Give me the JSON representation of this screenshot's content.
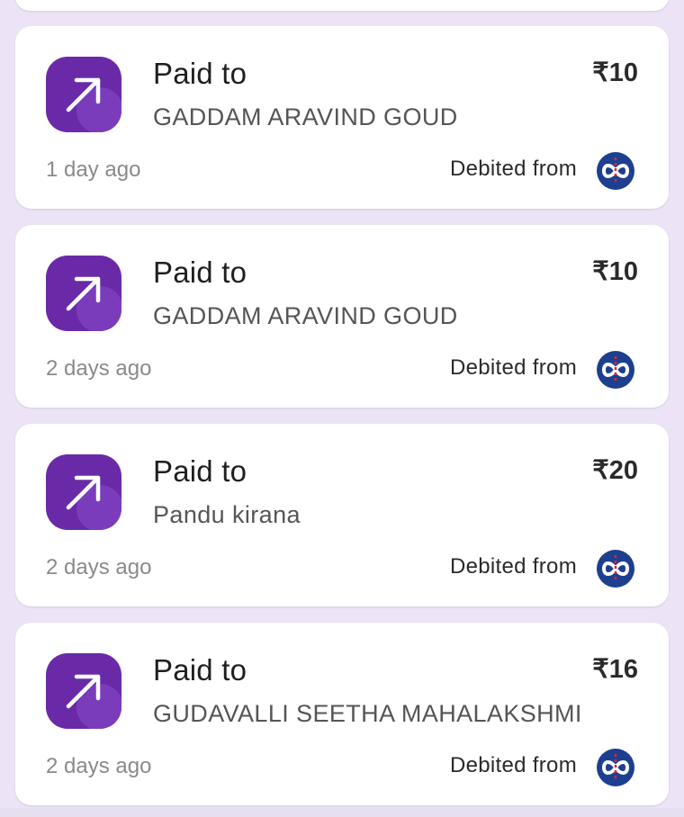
{
  "colors": {
    "background": "#ece4f6",
    "card": "#ffffff",
    "icon_bg": "#6a2aa8",
    "bank_logo_blue": "#1d3f8f",
    "bank_logo_red": "#e4242b"
  },
  "transactions": [
    {
      "label": "Paid to",
      "payee": "GADDAM ARAVIND GOUD",
      "amount": "₹10",
      "time": "1 day ago",
      "debited_label": "Debited from",
      "icon": "arrow-up-right-icon",
      "bank_icon": "kotak-bank-logo-icon"
    },
    {
      "label": "Paid to",
      "payee": "GADDAM ARAVIND GOUD",
      "amount": "₹10",
      "time": "2 days ago",
      "debited_label": "Debited from",
      "icon": "arrow-up-right-icon",
      "bank_icon": "kotak-bank-logo-icon"
    },
    {
      "label": "Paid to",
      "payee": "Pandu kirana",
      "amount": "₹20",
      "time": "2 days ago",
      "debited_label": "Debited from",
      "icon": "arrow-up-right-icon",
      "bank_icon": "kotak-bank-logo-icon"
    },
    {
      "label": "Paid to",
      "payee": "GUDAVALLI SEETHA MAHALAKSHMI",
      "amount": "₹16",
      "time": "2 days ago",
      "debited_label": "Debited from",
      "icon": "arrow-up-right-icon",
      "bank_icon": "kotak-bank-logo-icon"
    }
  ]
}
